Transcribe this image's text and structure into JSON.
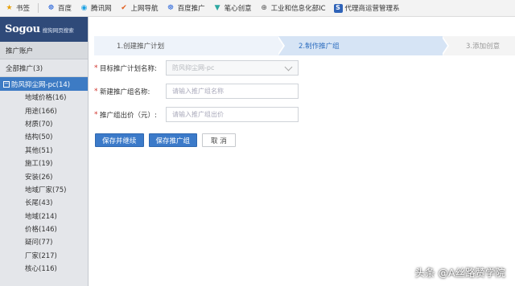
{
  "bookmarks": [
    {
      "icon": "star-icon",
      "label": "书签"
    },
    {
      "icon": "baidu-paw-icon",
      "label": "百度"
    },
    {
      "icon": "tencent-icon",
      "label": "腾讯网"
    },
    {
      "icon": "nav-check-icon",
      "label": "上网导航"
    },
    {
      "icon": "baidu-paw-icon",
      "label": "百度推广"
    },
    {
      "icon": "idea-icon",
      "label": "笔心创意"
    },
    {
      "icon": "globe-icon",
      "label": "工业和信息化部IC"
    },
    {
      "icon": "s-logo-icon",
      "label": "代理商运营管理系"
    }
  ],
  "sidebar": {
    "logo": "Sogou",
    "logo_sub": "搜狗网页搜索",
    "section_title": "推广账户",
    "all_label": "全部推广(3)",
    "active_plan": "防风抑尘网-pc(14)",
    "groups": [
      "地域价格(16)",
      "用途(166)",
      "材质(70)",
      "结构(50)",
      "其他(51)",
      "施工(19)",
      "安装(26)",
      "地域厂家(75)",
      "长尾(43)",
      "地域(214)",
      "价格(146)",
      "疑问(77)",
      "厂家(217)",
      "核心(116)"
    ]
  },
  "steps": {
    "step1": "1.创建推广计划",
    "step2": "2.制作推广组",
    "step3": "3.添加创意"
  },
  "form": {
    "plan_label": "目标推广计划名称:",
    "plan_value": "防风抑尘网-pc",
    "group_name_label": "新建推广组名称:",
    "group_name_placeholder": "请输入推广组名称",
    "bid_label": "推广组出价（元）:",
    "bid_placeholder": "请输入推广组出价",
    "required_mark": "*"
  },
  "buttons": {
    "save_continue": "保存并继续",
    "save_group": "保存推广组",
    "cancel": "取 消"
  },
  "watermark": "头条 @A丝路赞学院",
  "colors": {
    "accent": "#3b7ac9",
    "sidebar_active": "#3d7bc4",
    "logo_bar": "#2f4a79"
  }
}
